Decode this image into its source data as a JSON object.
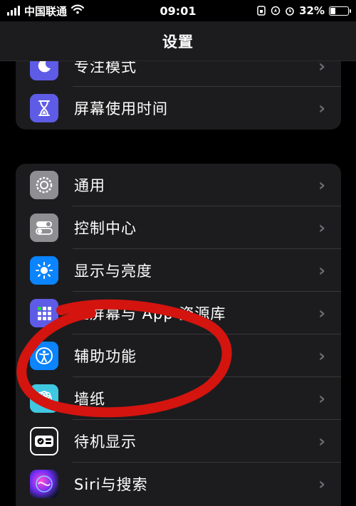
{
  "status_bar": {
    "carrier": "中国联通",
    "time": "09:01",
    "battery_percent": "32%",
    "battery_level": 0.32,
    "icons": [
      "signal-icon",
      "wifi-icon",
      "lock-rotation-icon",
      "location-icon",
      "alarm-icon",
      "battery-icon"
    ]
  },
  "nav": {
    "title": "设置"
  },
  "group1": {
    "items": [
      {
        "label": "专注模式",
        "icon": "moon-icon"
      },
      {
        "label": "屏幕使用时间",
        "icon": "hourglass-icon"
      }
    ]
  },
  "group2": {
    "items": [
      {
        "label": "通用",
        "icon": "gear-icon"
      },
      {
        "label": "控制中心",
        "icon": "toggles-icon"
      },
      {
        "label": "显示与亮度",
        "icon": "sun-icon"
      },
      {
        "label": "主屏幕与 App 资源库",
        "icon": "home-grid-icon"
      },
      {
        "label": "辅助功能",
        "icon": "accessibility-icon"
      },
      {
        "label": "墙纸",
        "icon": "flower-icon"
      },
      {
        "label": "待机显示",
        "icon": "standby-icon"
      },
      {
        "label": "Siri与搜索",
        "icon": "siri-icon"
      }
    ]
  },
  "colors": {
    "annotation": "#d4140f",
    "chevron": "#6b6b70",
    "row_bg": "#1c1c1e"
  }
}
